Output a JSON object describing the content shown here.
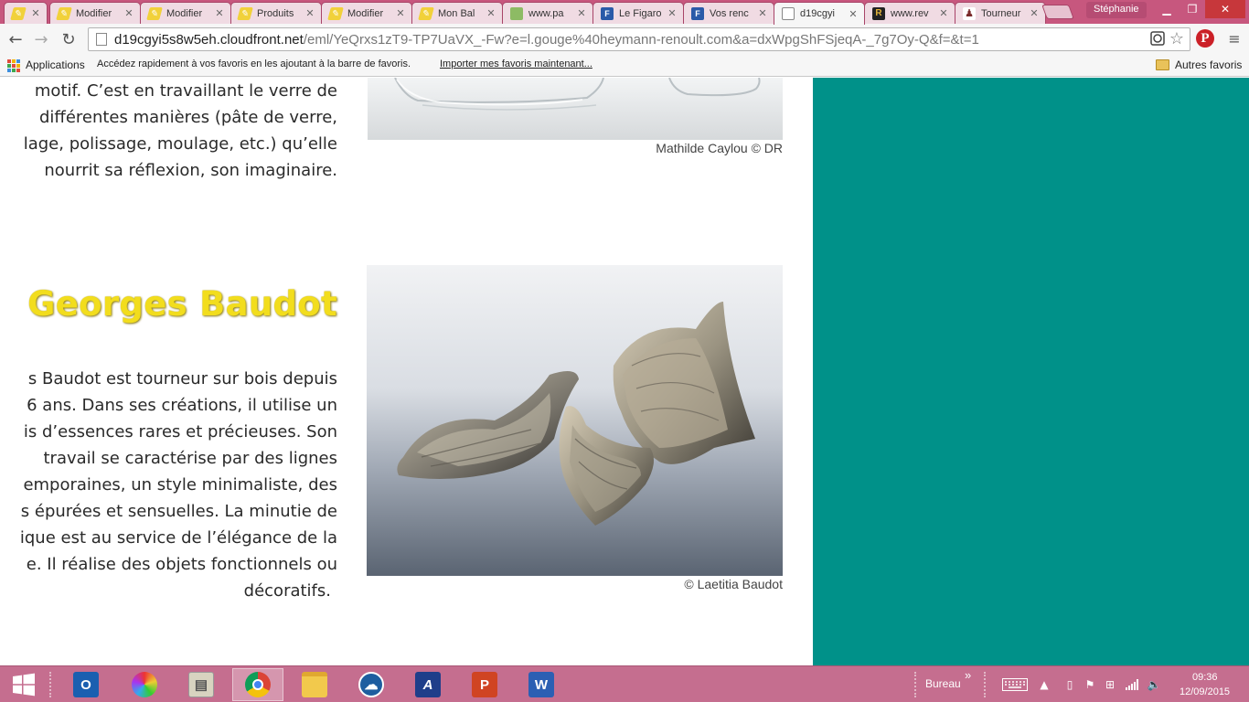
{
  "browser": {
    "tabs": [
      {
        "label": "",
        "icon": "pen-icon"
      },
      {
        "label": "Modifier",
        "icon": "pen-icon"
      },
      {
        "label": "Modifier",
        "icon": "pen-icon"
      },
      {
        "label": "Produits",
        "icon": "pen-icon"
      },
      {
        "label": "Modifier",
        "icon": "pen-icon"
      },
      {
        "label": "Mon Bal",
        "icon": "pen-icon"
      },
      {
        "label": "www.pa",
        "icon": "map-icon"
      },
      {
        "label": "Le Figaro",
        "icon": "figaro-icon"
      },
      {
        "label": "Vos renc",
        "icon": "figaro-icon"
      },
      {
        "label": "d19cgyi",
        "icon": "page-icon"
      },
      {
        "label": "www.rev",
        "icon": "r-icon"
      },
      {
        "label": "Tourneur",
        "icon": "turner-icon"
      }
    ],
    "profile": "Stéphanie",
    "url_host": "d19cgyi5s8w5eh.cloudfront.net",
    "url_path": "/eml/YeQrxs1zT9-TP7UaVX_-Fw?e=l.gouge%40heymann-renoult.com&a=dxWpgShFSjeqA-_7g7Oy-Q&f=&t=1",
    "bookmarks": {
      "apps": "Applications",
      "hint": "Accédez rapidement à vos favoris en les ajoutant à la barre de favoris.",
      "import": "Importer mes favoris maintenant...",
      "other": "Autres favoris"
    }
  },
  "article": {
    "paragraph1": [
      "motif. C’est en travaillant le verre de",
      "différentes manières (pâte de verre,",
      "lage, polissage, moulage, etc.) qu’elle",
      "nourrit sa réflexion, son imaginaire."
    ],
    "caption1": "Mathilde Caylou © DR",
    "heading": "Georges Baudot",
    "paragraph2": [
      "s Baudot est tourneur sur bois depuis",
      "6 ans. Dans ses créations, il utilise un",
      "is d’essences rares et précieuses. Son",
      "travail se caractérise par des lignes",
      "emporaines, un style minimaliste, des",
      "s épurées et sensuelles. La minutie de",
      "ique est au service de l’élégance de la",
      "e. Il réalise des objets fonctionnels ou",
      "décoratifs."
    ],
    "caption2": "© Laetitia Baudot"
  },
  "colors": {
    "panel": "#009189",
    "heading": "#f2dd1d",
    "tabstrip": "#c7577e",
    "taskbar": "#c56e8f"
  },
  "taskbar": {
    "apps": [
      "outlook-icon",
      "color-wheel-icon",
      "scanner-icon",
      "chrome-icon",
      "explorer-icon",
      "cloud-sync-icon",
      "autodesk-icon",
      "powerpoint-icon",
      "word-icon"
    ],
    "toolbar_label": "Bureau",
    "toolbar_chevron": "»",
    "time": "09:36",
    "date": "12/09/2015"
  }
}
